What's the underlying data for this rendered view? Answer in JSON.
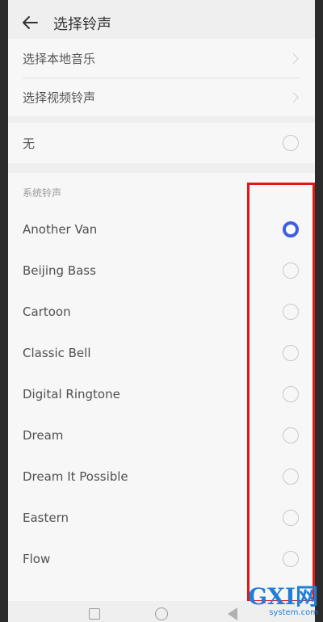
{
  "header": {
    "title": "选择铃声"
  },
  "local": {
    "items": [
      {
        "label": "选择本地音乐"
      },
      {
        "label": "选择视频铃声"
      }
    ]
  },
  "none_option": {
    "label": "无"
  },
  "system": {
    "section_label": "系统铃声",
    "selected": "Another Van",
    "items": [
      {
        "label": "Another Van"
      },
      {
        "label": "Beijing Bass"
      },
      {
        "label": "Cartoon"
      },
      {
        "label": "Classic Bell"
      },
      {
        "label": "Digital Ringtone"
      },
      {
        "label": "Dream"
      },
      {
        "label": "Dream It Possible"
      },
      {
        "label": "Eastern"
      },
      {
        "label": "Flow"
      }
    ]
  },
  "colors": {
    "accent": "#3d5fe0",
    "highlight": "#e01818",
    "watermark": "#1f7fd8"
  },
  "watermark": {
    "logo": "GXI网",
    "url": "system.com"
  }
}
